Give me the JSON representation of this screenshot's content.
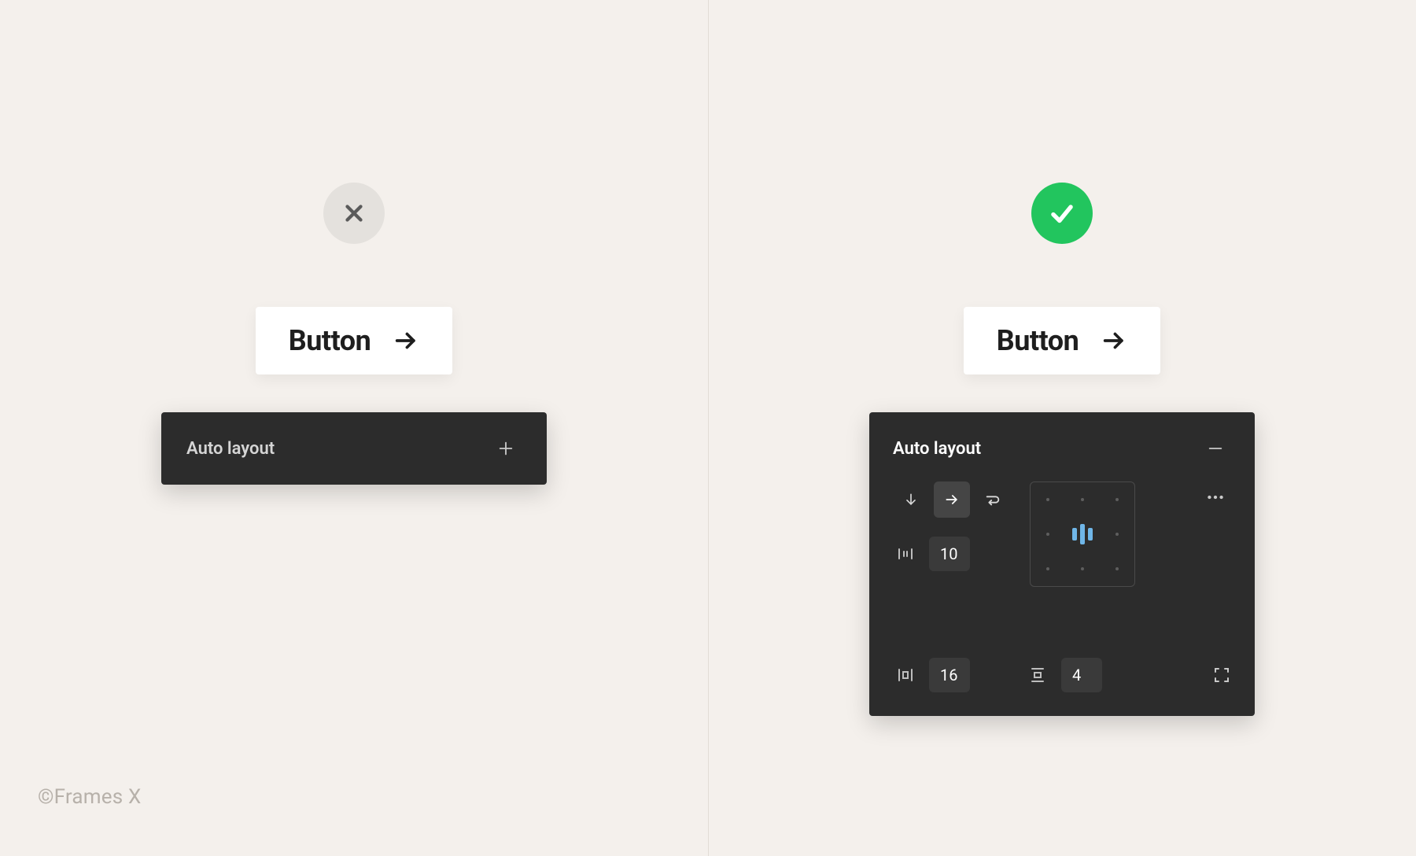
{
  "watermark": "©Frames X",
  "left": {
    "status_icon": "close-icon",
    "button_label": "Button",
    "panel": {
      "title": "Auto layout",
      "action_icon": "plus-icon"
    }
  },
  "right": {
    "status_icon": "check-icon",
    "button_label": "Button",
    "panel": {
      "title": "Auto layout",
      "action_icon": "minus-icon",
      "direction_selected": "horizontal",
      "spacing": "10",
      "padding_horizontal": "16",
      "padding_vertical": "4",
      "alignment": "center-center"
    }
  },
  "colors": {
    "good": "#22c55e",
    "bad_bg": "#e4e1dd",
    "panel_bg": "#2c2c2c",
    "accent_blue": "#6fb6e8"
  }
}
